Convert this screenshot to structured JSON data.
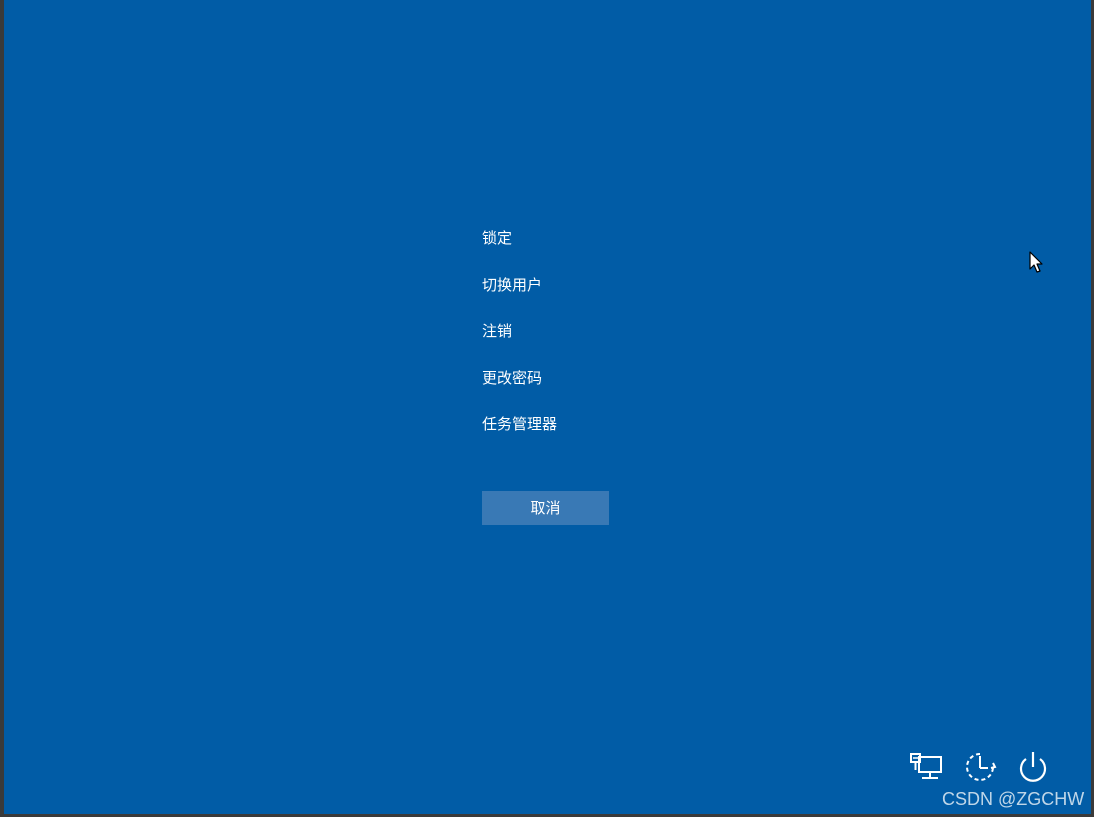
{
  "menu": {
    "items": [
      {
        "label": "锁定"
      },
      {
        "label": "切换用户"
      },
      {
        "label": "注销"
      },
      {
        "label": "更改密码"
      },
      {
        "label": "任务管理器"
      }
    ]
  },
  "cancel_button": {
    "label": "取消"
  },
  "tray": {
    "icons": [
      "network-icon",
      "accessibility-icon",
      "power-icon"
    ]
  },
  "watermark": "CSDN @ZGCHW",
  "colors": {
    "background": "#015ca6",
    "button": "#3979b5",
    "text": "#ffffff"
  }
}
